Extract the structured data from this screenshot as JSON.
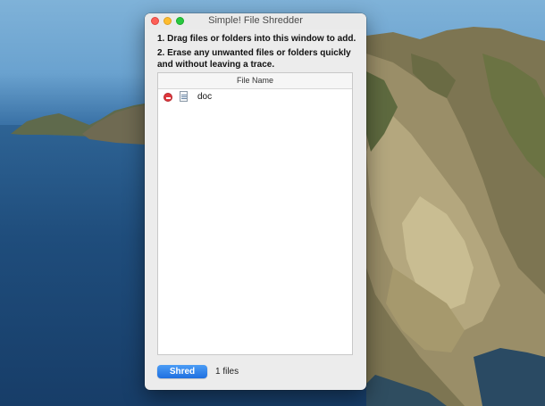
{
  "window": {
    "title": "Simple! File Shredder"
  },
  "instructions": {
    "line1": "1. Drag files or folders into this window to add.",
    "line2": "2. Erase any unwanted files or folders quickly and without leaving a trace."
  },
  "file_table": {
    "header": "File Name",
    "rows": [
      {
        "name": "doc",
        "remove_icon": "remove-circle-icon",
        "file_icon": "document-icon"
      }
    ]
  },
  "footer": {
    "shred_label": "Shred",
    "count_text": "1 files"
  },
  "colors": {
    "accent": "#1e6fe0",
    "remove": "#e0383e"
  }
}
